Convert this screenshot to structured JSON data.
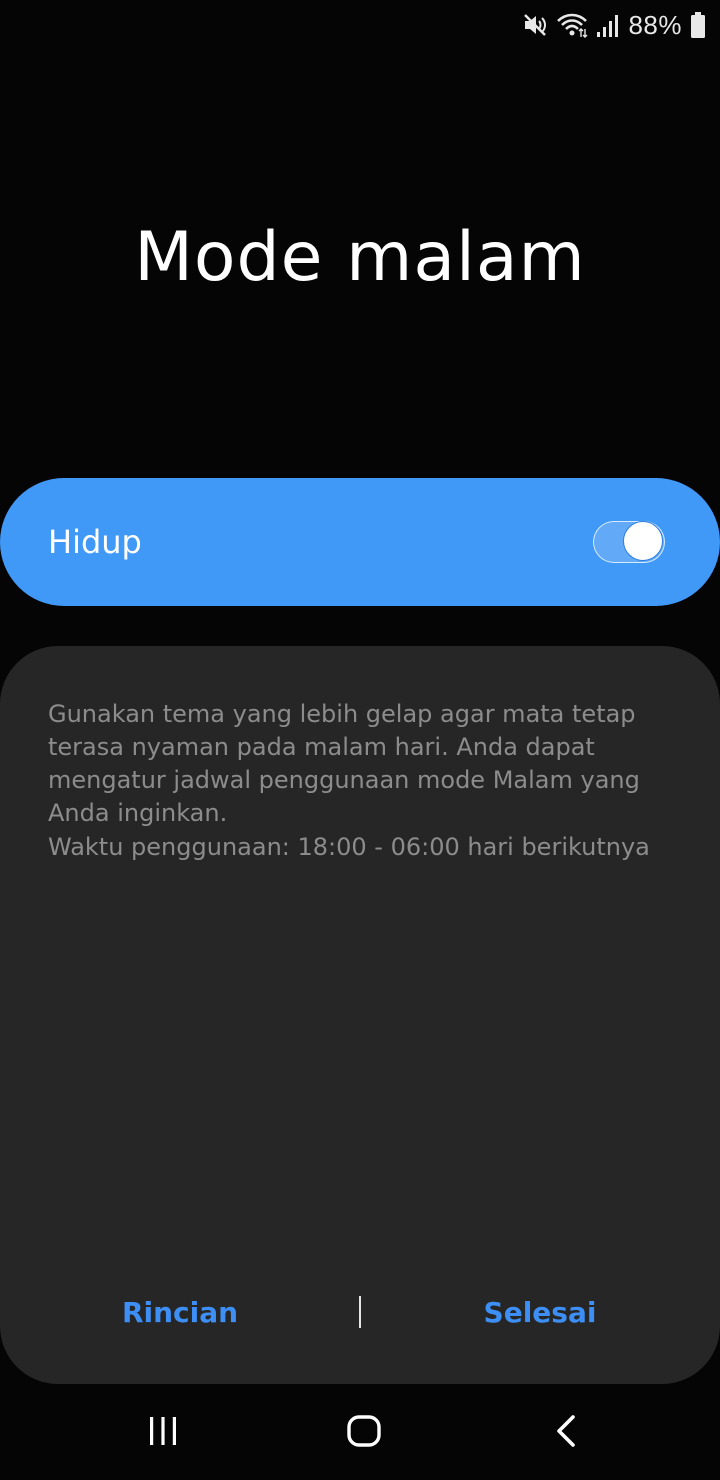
{
  "status_bar": {
    "icons": [
      "mute-icon",
      "wifi-icon",
      "signal-icon",
      "battery-icon"
    ],
    "battery_percent": "88%"
  },
  "title": "Mode malam",
  "switch": {
    "label": "Hidup",
    "state": "on",
    "accent_color": "#4098f7"
  },
  "description": {
    "body": "Gunakan tema yang lebih gelap agar mata tetap terasa nyaman pada malam hari. Anda dapat mengatur jadwal penggunaan mode Malam yang Anda inginkan.",
    "schedule": "Waktu penggunaan: 18:00 - 06:00 hari berikutnya"
  },
  "buttons": {
    "details_label": "Rincian",
    "done_label": "Selesai",
    "color": "#3d8ff5"
  },
  "nav_bar": {
    "icons": [
      "recent-apps-icon",
      "home-icon",
      "back-icon"
    ]
  }
}
